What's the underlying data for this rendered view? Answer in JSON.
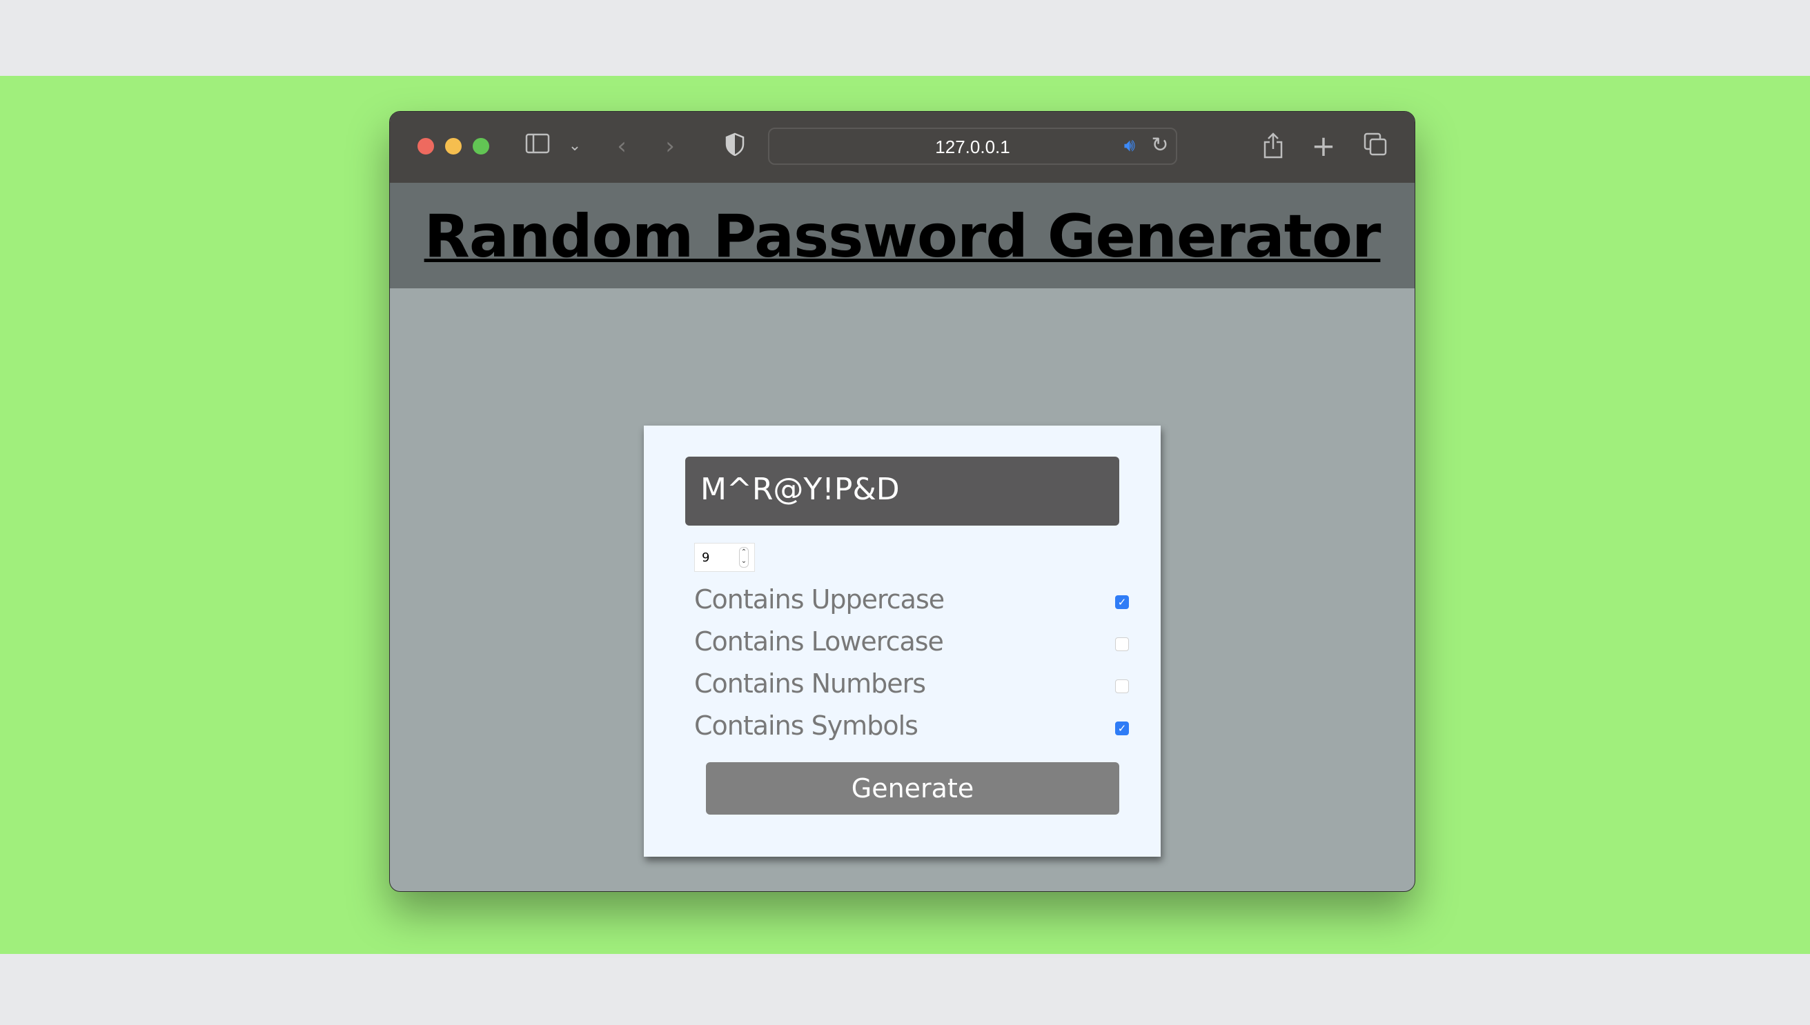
{
  "browser": {
    "url": "127.0.0.1",
    "icons": [
      "sidebar-icon",
      "chevron-down-icon",
      "back-icon",
      "forward-icon",
      "shield-icon",
      "speaker-icon",
      "reload-icon",
      "share-icon",
      "plus-icon",
      "tabs-icon"
    ]
  },
  "page": {
    "title": "Random Password Generator",
    "password": "M^R@Y!P&D",
    "length": "9",
    "options": [
      {
        "label": "Contains Uppercase",
        "checked": true
      },
      {
        "label": "Contains Lowercase",
        "checked": false
      },
      {
        "label": "Contains Numbers",
        "checked": false
      },
      {
        "label": "Contains Symbols",
        "checked": true
      }
    ],
    "generate_label": "Generate"
  },
  "colors": {
    "background": "#a0ef7c",
    "checkbox_accent": "#2f7cf6"
  }
}
